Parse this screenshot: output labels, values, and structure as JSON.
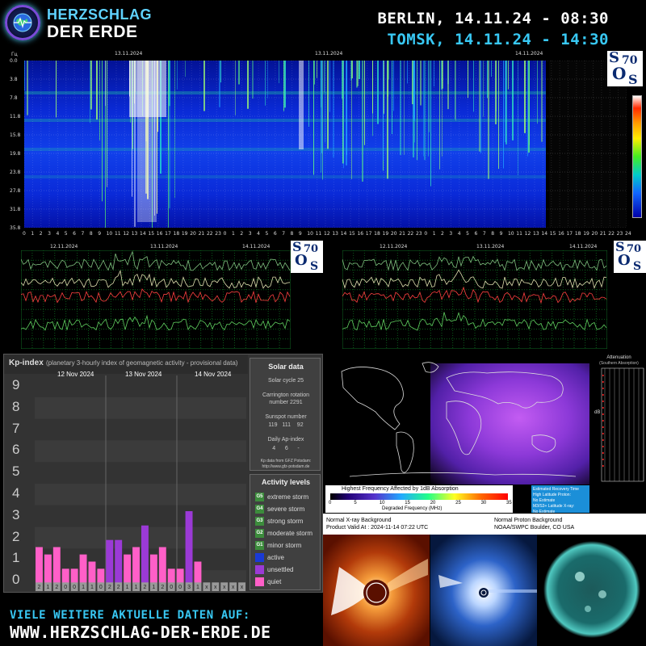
{
  "header": {
    "brand_line1": "HERZSCHLAG",
    "brand_line2": "DER ERDE",
    "city1": "BERLIN, 14.11.24 - 08:30",
    "city2": "TOMSK, 14.11.24 - 14:30"
  },
  "spectrogram": {
    "date_labels": [
      "13.11.2024",
      "13.11.2024",
      "14.11.2024"
    ],
    "y_unit": "Гц",
    "y_labels": [
      "0.0",
      "3.8",
      "7.8",
      "11.8",
      "15.8",
      "19.8",
      "23.8",
      "27.8",
      "31.8",
      "35.8"
    ],
    "x_hours": [
      "0",
      "1",
      "2",
      "3",
      "4",
      "5",
      "6",
      "7",
      "8",
      "9",
      "10",
      "11",
      "12",
      "13",
      "14",
      "15",
      "16",
      "17",
      "18",
      "19",
      "20",
      "21",
      "22",
      "23",
      "0",
      "1",
      "2",
      "3",
      "4",
      "5",
      "6",
      "7",
      "8",
      "9",
      "10",
      "11",
      "12",
      "13",
      "14",
      "15",
      "16",
      "17",
      "18",
      "19",
      "20",
      "21",
      "22",
      "23",
      "0",
      "1",
      "2",
      "3",
      "4",
      "5",
      "6",
      "7",
      "8",
      "9",
      "10",
      "11",
      "12",
      "13",
      "14",
      "15",
      "16",
      "17",
      "18",
      "19",
      "20",
      "21",
      "22",
      "23",
      "24"
    ]
  },
  "sos_badge": {
    "s1": "S",
    "num": "70",
    "o": "O",
    "s2": "S"
  },
  "mini_charts": {
    "left_dates": [
      "12.11.2024",
      "13.11.2024",
      "14.11.2024"
    ],
    "right_dates": [
      "12.11.2024",
      "13.11.2024",
      "14.11.2024"
    ]
  },
  "kp": {
    "title": "Kp-index",
    "subtitle": "(planetary 3-hourly index of geomagnetic activity - provisional data)",
    "dates": [
      "12 Nov 2024",
      "13 Nov 2024",
      "14 Nov 2024"
    ],
    "y_labels": [
      "9",
      "8",
      "7",
      "6",
      "5",
      "4",
      "3",
      "2",
      "1",
      "0"
    ],
    "bar_values": [
      1.67,
      1.33,
      1.67,
      0.67,
      0.67,
      1.33,
      1.0,
      0.67,
      2.0,
      2.0,
      1.33,
      1.67,
      2.67,
      1.33,
      1.67,
      0.67,
      0.67,
      3.33,
      1.0
    ],
    "bar_labels": [
      "2",
      "1",
      "2",
      "0",
      "0",
      "1",
      "1",
      "0",
      "2",
      "2",
      "1",
      "1",
      "2",
      "1",
      "2",
      "0",
      "0",
      "3",
      "1",
      "x",
      "x",
      "x",
      "x",
      "x"
    ],
    "colors": {
      "unsettled": "#9b3ad6",
      "quiet": "#ff5fc8",
      "chart_bg": "#3b3b3b"
    }
  },
  "solar": {
    "title": "Solar data",
    "cycle": "Solar cycle 25",
    "rotation_l1": "Carrington rotation",
    "rotation_l2": "number 2291",
    "sunspot_title": "Sunspot number",
    "sunspot_values": "119   111    92",
    "ap_title": "Daily Ap-index",
    "ap_values": "4      6      -",
    "source_l1": "Kp data from GFZ Potsdam:",
    "source_l2": "http://www.gfz-potsdam.de"
  },
  "activity": {
    "title": "Activity levels",
    "levels": [
      {
        "code": "G5",
        "label": "extreme storm",
        "color": "#3c8c3c"
      },
      {
        "code": "G4",
        "label": "severe storm",
        "color": "#3c8c3c"
      },
      {
        "code": "G3",
        "label": "strong storm",
        "color": "#3c8c3c"
      },
      {
        "code": "G2",
        "label": "moderate storm",
        "color": "#3c8c3c"
      },
      {
        "code": "G1",
        "label": "minor storm",
        "color": "#3c8c3c"
      },
      {
        "code": "",
        "label": "active",
        "color": "#1a3ad6"
      },
      {
        "code": "",
        "label": "unsettled",
        "color": "#9b3ad6"
      },
      {
        "code": "",
        "label": "quiet",
        "color": "#ff5fc8"
      }
    ]
  },
  "drap": {
    "title": "Highest Frequency Affected by 1dB Absorption",
    "ticks": [
      "0",
      "5",
      "10",
      "15",
      "20",
      "25",
      "30",
      "35"
    ],
    "unit": "Degraded Frequency (MHz)",
    "recovery_title": "Estimated Recovery Time",
    "recovery_l1": "High Latitude Proton:",
    "recovery_l2": "No Estimate",
    "recovery_l3": "M3/S3+ Latitude X-ray:",
    "recovery_l4": "No Estimate",
    "abs_title": "Attenuation",
    "abs_sub": "(Southern Absorption)",
    "abs_unit": "dB"
  },
  "xray": {
    "l1": "Normal X-ray Background",
    "l2": "Product Valid At : 2024-11-14 07:22 UTC",
    "r1": "Normal Proton Background",
    "r2": "NOAA/SWPC Boulder, CO USA"
  },
  "footer": {
    "line1": "VIELE WEITERE AKTUELLE DATEN AUF:",
    "line2": "WWW.HERZSCHLAG-DER-ERDE.DE"
  }
}
